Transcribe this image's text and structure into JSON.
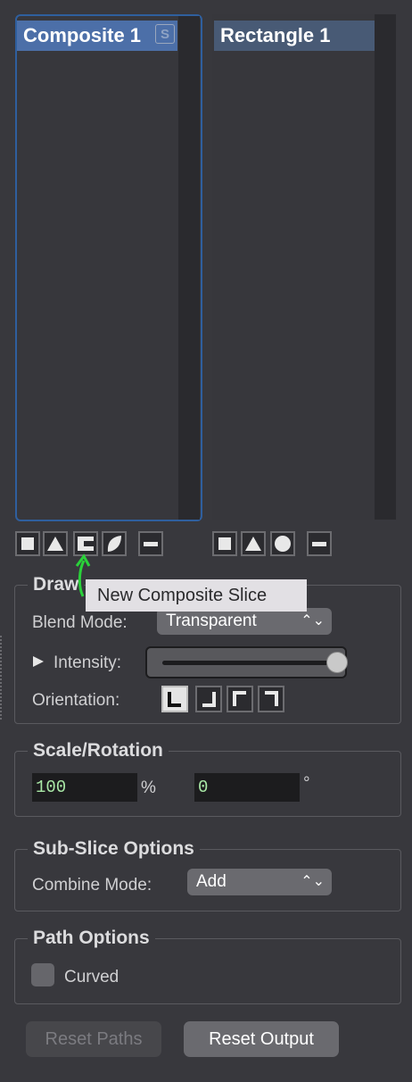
{
  "lists": {
    "left_title": "Composite 1",
    "left_badge": "S",
    "right_title": "Rectangle 1"
  },
  "tooltip": "New Composite Slice",
  "draw": {
    "title": "Draw",
    "blend_label": "Blend Mode:",
    "blend_value": "Transparent",
    "intensity_label": "Intensity:",
    "intensity_level": 1.0,
    "orientation_label": "Orientation:"
  },
  "scale": {
    "title": "Scale/Rotation",
    "scale_value": "100",
    "scale_unit": "%",
    "rotation_value": "0",
    "rotation_unit": "°"
  },
  "subslice": {
    "title": "Sub-Slice Options",
    "combine_label": "Combine Mode:",
    "combine_value": "Add"
  },
  "path": {
    "title": "Path Options",
    "curved_label": "Curved",
    "curved_checked": false
  },
  "buttons": {
    "reset_paths": "Reset Paths",
    "reset_output": "Reset Output"
  },
  "colors": {
    "selection": "#4c6fa8",
    "focus_ring": "#2f5f9e",
    "field_text": "#a9e8a6",
    "arrow": "#2ad13a"
  }
}
